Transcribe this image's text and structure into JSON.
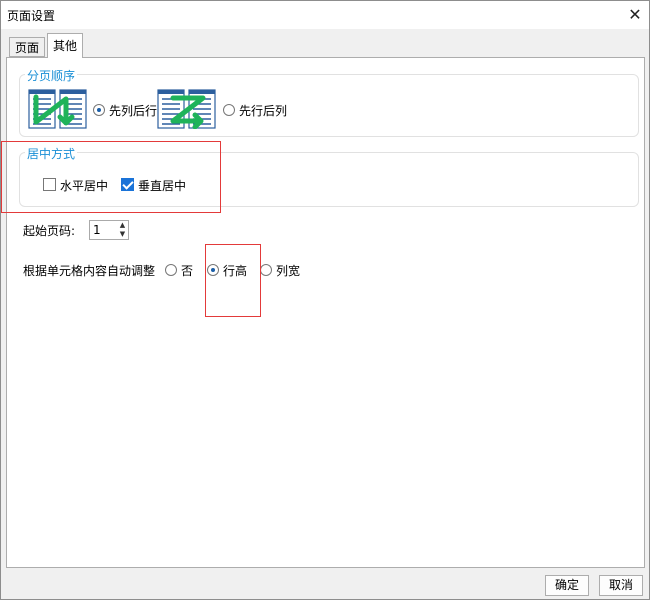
{
  "window": {
    "title": "页面设置"
  },
  "tabs": [
    {
      "label": "页面",
      "active": false
    },
    {
      "label": "其他",
      "active": true
    }
  ],
  "page_order": {
    "title": "分页顺序",
    "option1": {
      "label": "先列后行",
      "checked": true,
      "icon": "column-first-order-icon"
    },
    "option2": {
      "label": "先行后列",
      "checked": false,
      "icon": "row-first-order-icon"
    }
  },
  "centering": {
    "title": "居中方式",
    "horizontal": {
      "label": "水平居中",
      "checked": false
    },
    "vertical": {
      "label": "垂直居中",
      "checked": true
    }
  },
  "start_page": {
    "label": "起始页码:",
    "value": "1"
  },
  "auto_adjust": {
    "label": "根据单元格内容自动调整",
    "options": [
      {
        "label": "否",
        "checked": false
      },
      {
        "label": "行高",
        "checked": true
      },
      {
        "label": "列宽",
        "checked": false
      }
    ]
  },
  "buttons": {
    "ok": "确定",
    "cancel": "取消"
  },
  "colors": {
    "accent": "#1a8fd6",
    "icon_green": "#1fb35a",
    "icon_blue": "#2c5f9e",
    "highlight_red": "#e33a3a"
  }
}
